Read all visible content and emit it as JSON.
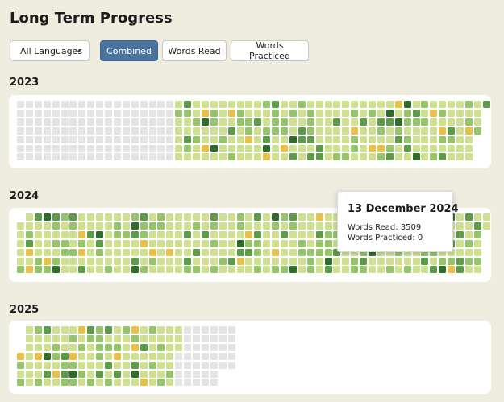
{
  "page": {
    "title": "Long Term Progress"
  },
  "controls": {
    "language_select": {
      "value": "All Languages",
      "icon": "chevron-down-icon"
    },
    "buttons": [
      {
        "id": "combined",
        "label": "Combined",
        "active": true
      },
      {
        "id": "words-read",
        "label": "Words Read",
        "active": false
      },
      {
        "id": "words-practiced",
        "label": "Words Practiced",
        "active": false
      }
    ]
  },
  "colors": {
    "background": "#efece0",
    "empty": "#e4e4e4",
    "light": "#cfe092",
    "medium": "#95c46d",
    "strong": "#5d9a4c",
    "darkest": "#2f6b2c",
    "yellow": "#e9c04b",
    "accent_button": "#4a739e"
  },
  "years": [
    {
      "label": "2023"
    },
    {
      "label": "2024"
    },
    {
      "label": "2025"
    }
  ],
  "tooltip": {
    "date": "13 December 2024",
    "words_read_label": "Words Read: 3509",
    "words_practiced_label": "Words Practiced: 0"
  }
}
